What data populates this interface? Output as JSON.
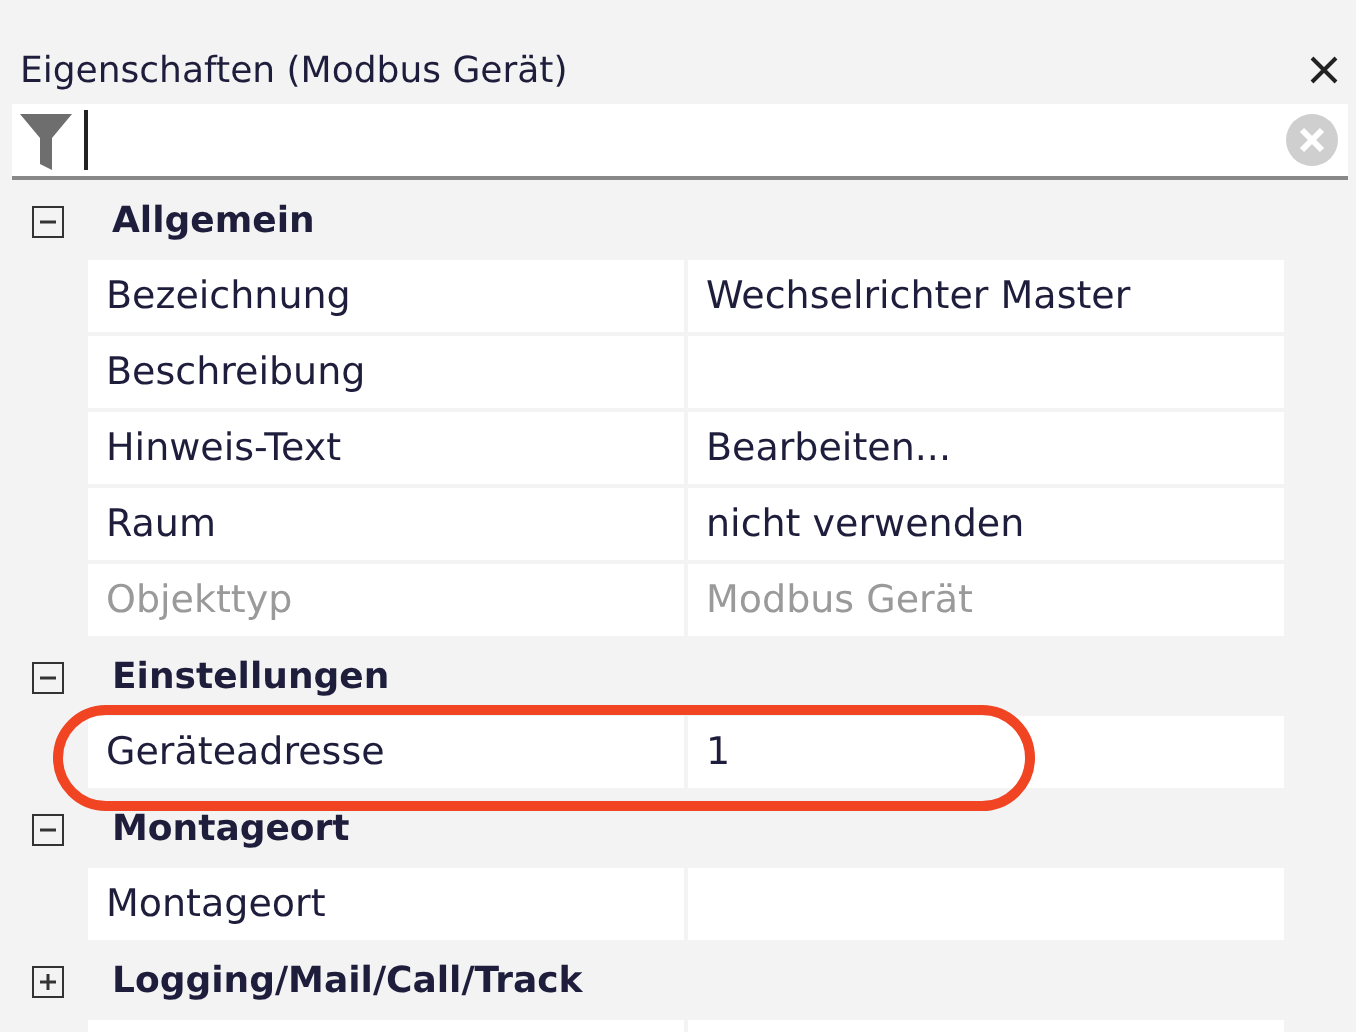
{
  "panel": {
    "title": "Eigenschaften (Modbus Gerät)"
  },
  "categories": [
    {
      "name": "Allgemein",
      "expanded": true,
      "rows": [
        {
          "label": "Bezeichnung",
          "value": "Wechselrichter Master",
          "disabled": false
        },
        {
          "label": "Beschreibung",
          "value": "",
          "disabled": false
        },
        {
          "label": "Hinweis-Text",
          "value": "Bearbeiten...",
          "disabled": false
        },
        {
          "label": "Raum",
          "value": "nicht verwenden",
          "disabled": false
        },
        {
          "label": "Objekttyp",
          "value": "Modbus Gerät",
          "disabled": true
        }
      ]
    },
    {
      "name": "Einstellungen",
      "expanded": true,
      "rows": [
        {
          "label": "Geräteadresse",
          "value": "1",
          "disabled": false
        }
      ]
    },
    {
      "name": "Montageort",
      "expanded": true,
      "rows": [
        {
          "label": "Montageort",
          "value": "",
          "disabled": false
        }
      ]
    },
    {
      "name": "Logging/Mail/Call/Track",
      "expanded": false
    }
  ]
}
